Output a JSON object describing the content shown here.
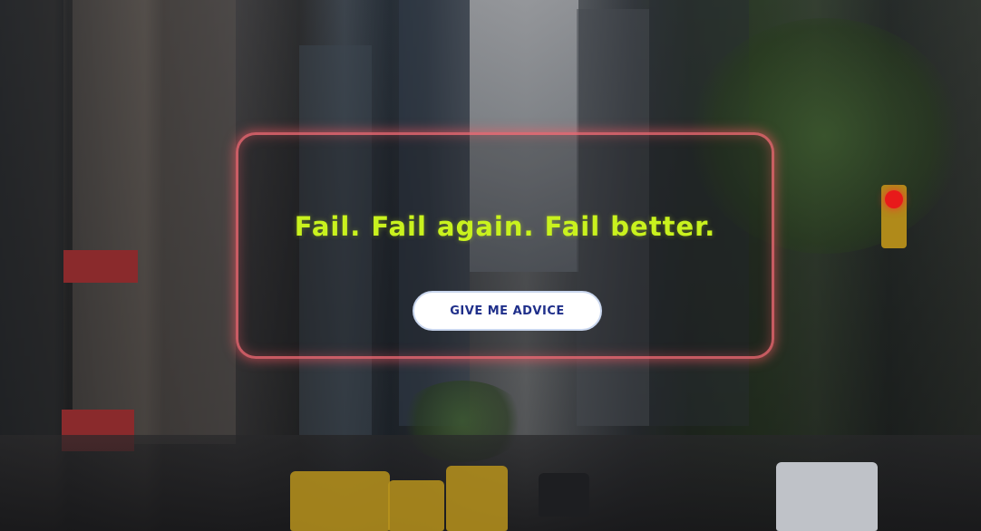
{
  "quote": {
    "text": "Fail. Fail again. Fail better."
  },
  "actions": {
    "advice_label": "GIVE ME ADVICE"
  },
  "colors": {
    "quote_text": "#c9f21e",
    "card_glow": "#ff6e78",
    "button_text": "#1f2f8a",
    "button_bg": "#ffffff"
  }
}
